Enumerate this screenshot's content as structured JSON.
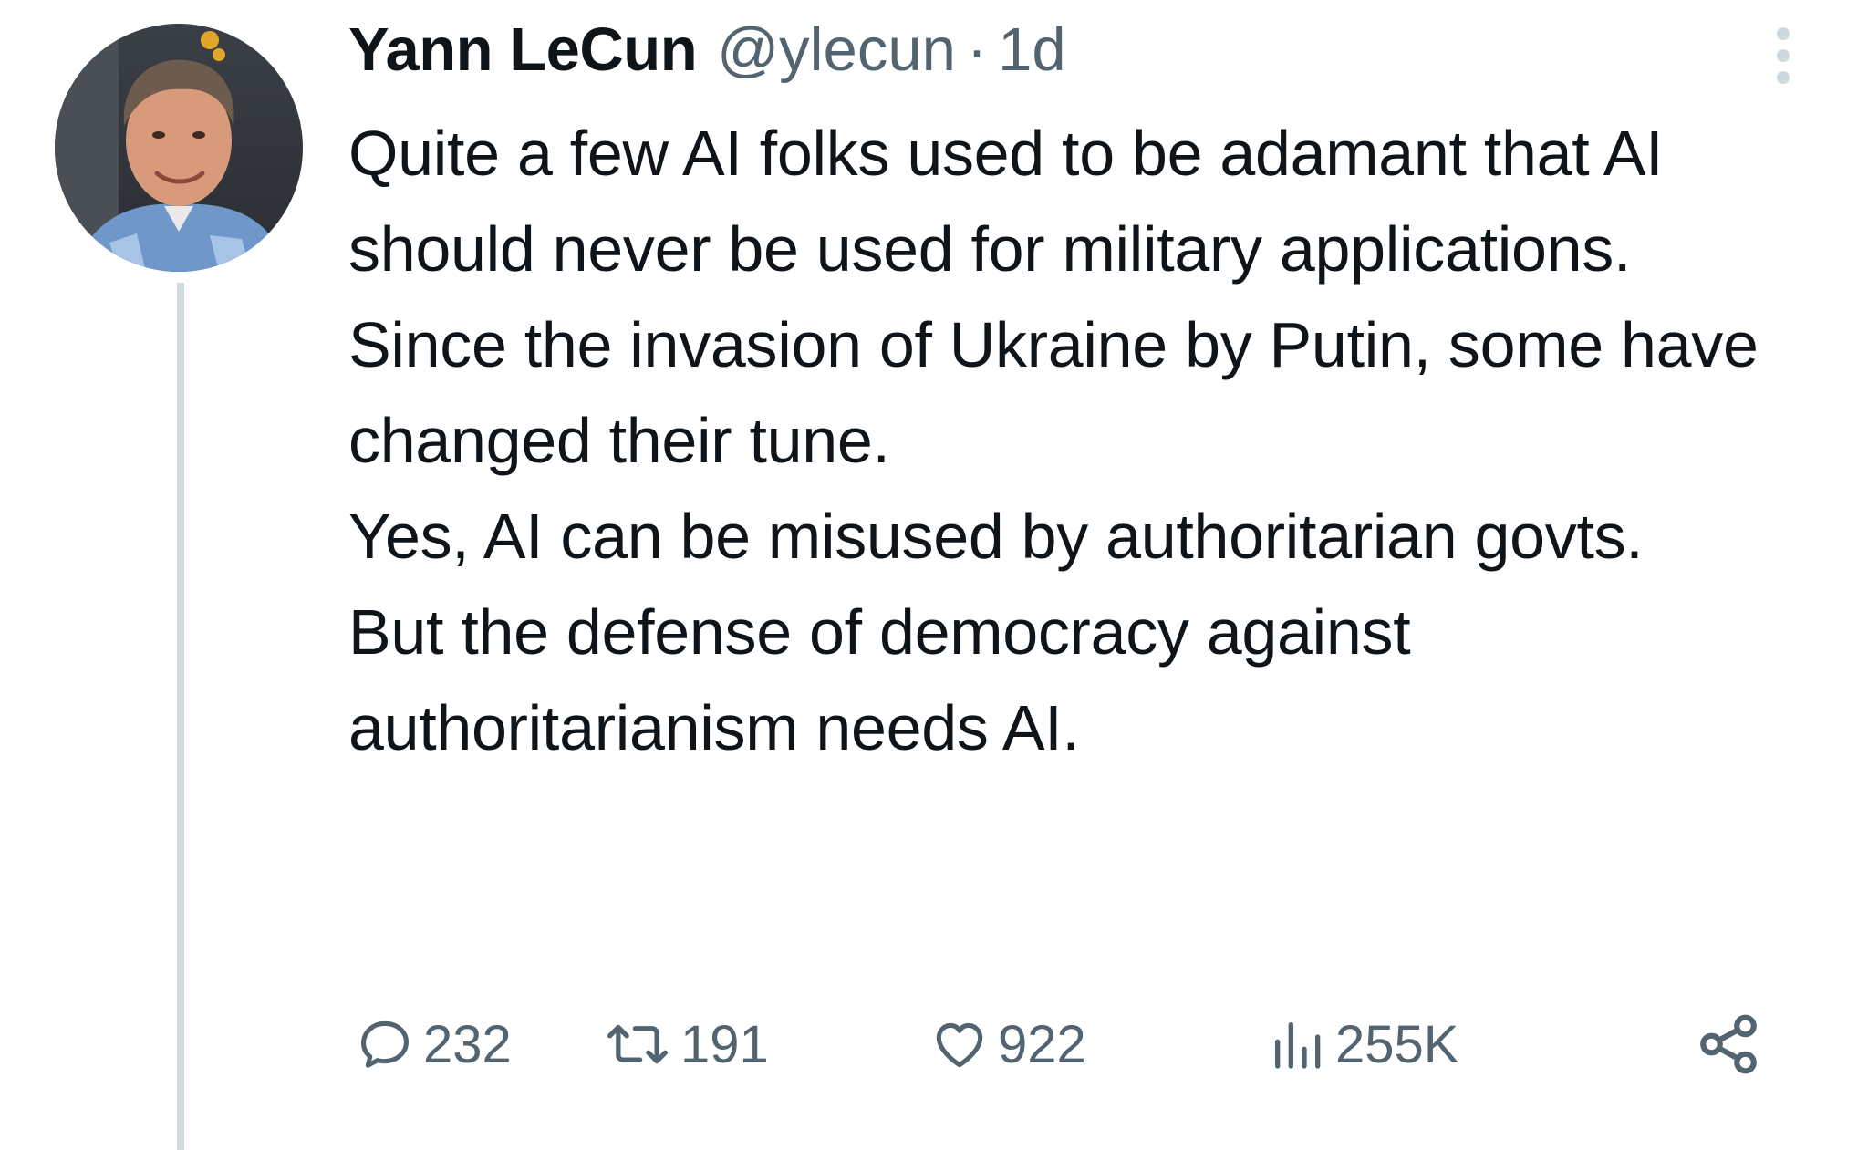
{
  "author": {
    "name": "Yann LeCun",
    "handle": "@ylecun",
    "separator": "·",
    "time": "1d"
  },
  "tweet": {
    "paragraphs": [
      "Quite a few AI folks used to be adamant that AI should never be used for military applications.",
      "Since the invasion of Ukraine by Putin, some have changed their tune.",
      "Yes, AI can be misused by authoritarian govts.",
      "But the defense of democracy against authoritarianism needs AI."
    ]
  },
  "actions": {
    "replies": "232",
    "reposts": "191",
    "likes": "922",
    "views": "255K"
  },
  "colors": {
    "text_primary": "#0f1419",
    "text_secondary": "#536471",
    "thread_line": "#cfd9de"
  },
  "icons": {
    "reply": "reply-icon",
    "repost": "repost-icon",
    "like": "heart-icon",
    "views": "views-icon",
    "share": "share-icon",
    "more": "more-vertical-icon"
  }
}
